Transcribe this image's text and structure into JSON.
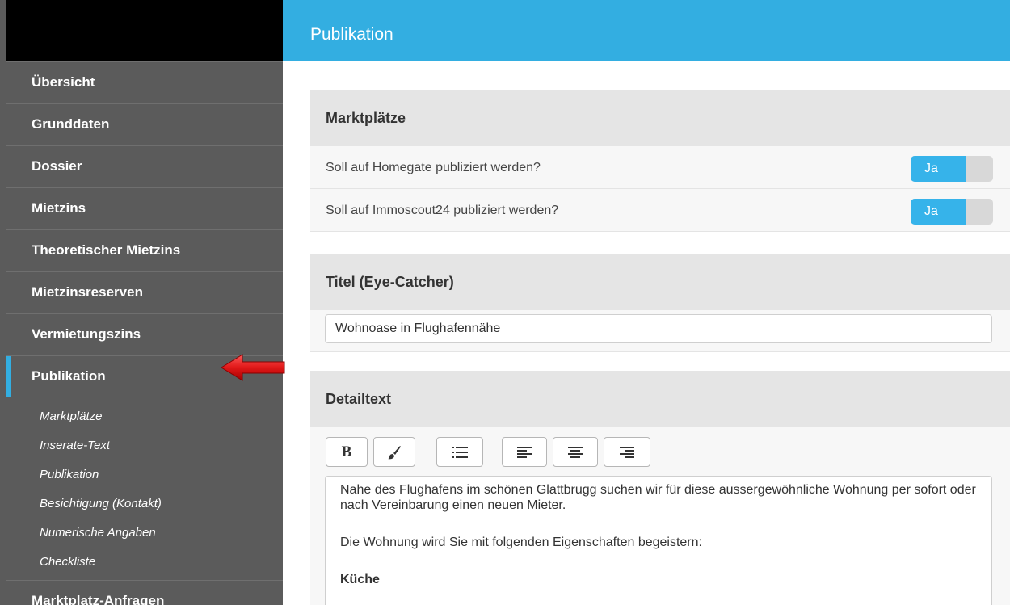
{
  "sidebar": {
    "items": [
      {
        "label": "Übersicht"
      },
      {
        "label": "Grunddaten"
      },
      {
        "label": "Dossier"
      },
      {
        "label": "Mietzins"
      },
      {
        "label": "Theoretischer Mietzins"
      },
      {
        "label": "Mietzinsreserven"
      },
      {
        "label": "Vermietungszins"
      },
      {
        "label": "Publikation",
        "active": true
      }
    ],
    "sub_items": [
      {
        "label": "Marktplätze"
      },
      {
        "label": "Inserate-Text"
      },
      {
        "label": "Publikation"
      },
      {
        "label": "Besichtigung (Kontakt)"
      },
      {
        "label": "Numerische Angaben"
      },
      {
        "label": "Checkliste"
      }
    ],
    "last_item": {
      "label": "Marktplatz-Anfragen"
    }
  },
  "header": {
    "title": "Publikation"
  },
  "marketplaces": {
    "title": "Marktplätze",
    "rows": [
      {
        "label": "Soll auf Homegate publiziert werden?",
        "toggle": "Ja"
      },
      {
        "label": "Soll auf Immoscout24 publiziert werden?",
        "toggle": "Ja"
      }
    ]
  },
  "eye_catcher": {
    "title": "Titel (Eye-Catcher)",
    "value": "Wohnoase in Flughafennähe"
  },
  "detail": {
    "title": "Detailtext",
    "toolbar": {
      "bold_label": "B"
    },
    "paragraph1": "Nahe des Flughafens im schönen Glattbrugg suchen wir für diese aussergewöhnliche Wohnung per sofort oder nach Vereinbarung einen neuen Mieter.",
    "paragraph2": "Die Wohnung wird Sie mit folgenden Eigenschaften begeistern:",
    "heading": "Küche"
  },
  "colors": {
    "accent": "#33aee1",
    "sidebar": "#5b5b5b",
    "arrow": "#e02020"
  }
}
